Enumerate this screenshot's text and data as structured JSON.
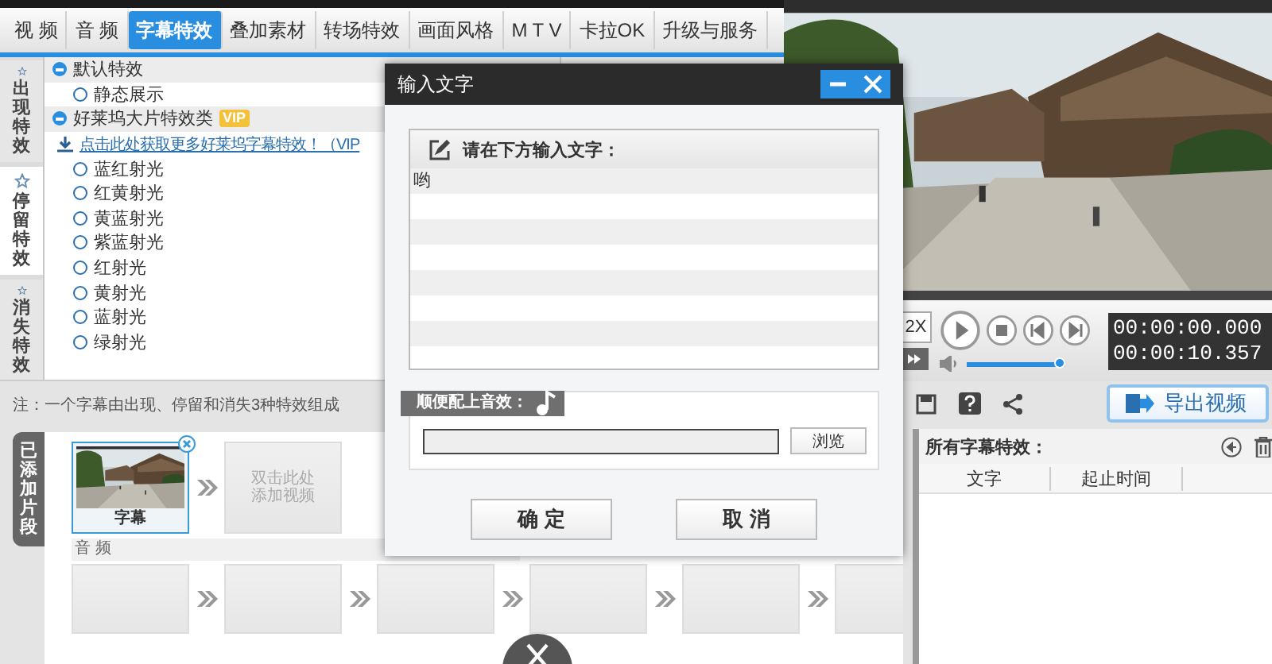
{
  "tabs": [
    {
      "label": "视 频",
      "selected": false
    },
    {
      "label": "音 频",
      "selected": false
    },
    {
      "label": "字幕特效",
      "selected": true
    },
    {
      "label": "叠加素材",
      "selected": false
    },
    {
      "label": "转场特效",
      "selected": false
    },
    {
      "label": "画面风格",
      "selected": false
    },
    {
      "label": "M T V",
      "selected": false
    },
    {
      "label": "卡拉OK",
      "selected": false
    },
    {
      "label": "升级与服务",
      "selected": false
    }
  ],
  "side_tabs": [
    {
      "label": "出现特效",
      "selected": false
    },
    {
      "label": "停留特效",
      "selected": true
    },
    {
      "label": "消失特效",
      "selected": false
    }
  ],
  "effect_groups": [
    {
      "name": "默认特效",
      "expanded": true,
      "items": [
        {
          "kind": "radio",
          "label": "静态展示",
          "selected": false
        }
      ]
    },
    {
      "name": "好莱坞大片特效类",
      "badge": "VIP",
      "expanded": true,
      "items": [
        {
          "kind": "link",
          "label": "点击此处获取更多好莱坞字幕特效！（VIP"
        },
        {
          "kind": "radio",
          "label": "蓝红射光",
          "selected": false
        },
        {
          "kind": "radio",
          "label": "红黄射光",
          "selected": false
        },
        {
          "kind": "radio",
          "label": "黄蓝射光",
          "selected": false
        },
        {
          "kind": "radio",
          "label": "紫蓝射光",
          "selected": false
        },
        {
          "kind": "radio",
          "label": "红射光",
          "selected": false
        },
        {
          "kind": "radio",
          "label": "黄射光",
          "selected": false
        },
        {
          "kind": "radio",
          "label": "蓝射光",
          "selected": false
        },
        {
          "kind": "radio",
          "label": "绿射光",
          "selected": false
        }
      ]
    }
  ],
  "player": {
    "speed": "2X",
    "time_current": "00:00:00.000",
    "time_total": "00:00:10.357",
    "volume": {
      "level": 0.95
    }
  },
  "note": "注：一个字幕由出现、停留和消失3种特效组成",
  "export_button": "导出视频",
  "timeline": {
    "title": "已添加片段",
    "video_clips": [
      {
        "kind": "clip",
        "caption": "字幕"
      },
      {
        "kind": "placeholder",
        "hint": "双击此处添加视频"
      }
    ],
    "audio_label": "音 频",
    "audio_clips": [
      {
        "kind": "empty"
      },
      {
        "kind": "empty"
      },
      {
        "kind": "empty"
      },
      {
        "kind": "empty"
      },
      {
        "kind": "empty"
      },
      {
        "kind": "empty"
      }
    ]
  },
  "effects_panel": {
    "title": "所有字幕特效：",
    "columns": [
      "文字",
      "起止时间"
    ]
  },
  "dialog": {
    "title": "输入文字",
    "prompt": "请在下方输入文字：",
    "value": "哟",
    "sound_label": "顺便配上音效：",
    "browse": "浏览",
    "buttons": [
      "确 定",
      "取 消"
    ]
  }
}
